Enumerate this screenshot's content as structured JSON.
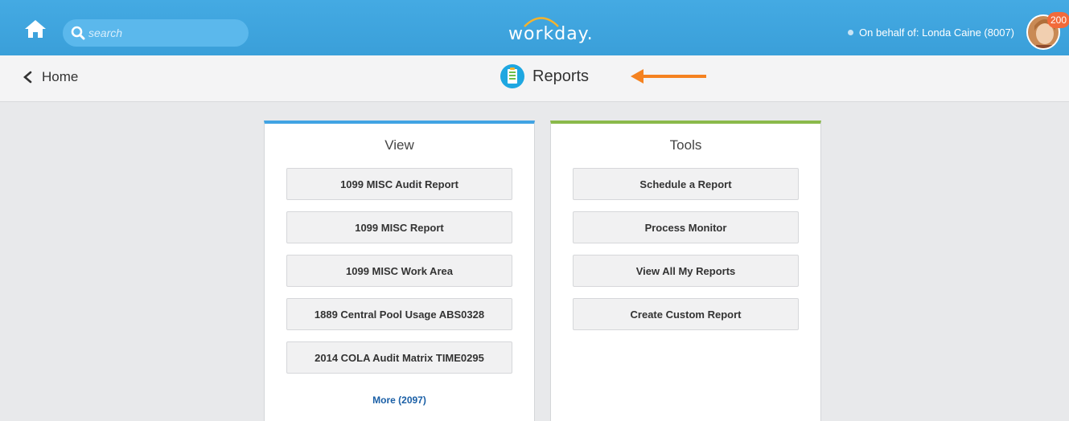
{
  "topbar": {
    "search_placeholder": "search",
    "logo_text": "workday.",
    "on_behalf": "On behalf of: Londa Caine (8007)",
    "notification_count": "200"
  },
  "subheader": {
    "back_label": "Home",
    "title": "Reports"
  },
  "view_card": {
    "title": "View",
    "items": [
      "1099 MISC Audit Report",
      "1099 MISC Report",
      "1099 MISC Work Area",
      "1889 Central Pool Usage ABS0328",
      "2014 COLA Audit Matrix TIME0295"
    ],
    "more_link": "More (2097)"
  },
  "tools_card": {
    "title": "Tools",
    "items": [
      "Schedule a Report",
      "Process Monitor",
      "View All My Reports",
      "Create Custom Report"
    ]
  },
  "colors": {
    "topbar": "#3fa5e0",
    "view_accent": "#41a3e3",
    "tools_accent": "#8ab94a",
    "arrow": "#f58220",
    "badge": "#f26a3a"
  },
  "icons": [
    "home-icon",
    "search-icon",
    "workday-logo-arc",
    "chevron-left-icon",
    "reports-icon",
    "arrow-left-icon",
    "avatar"
  ]
}
